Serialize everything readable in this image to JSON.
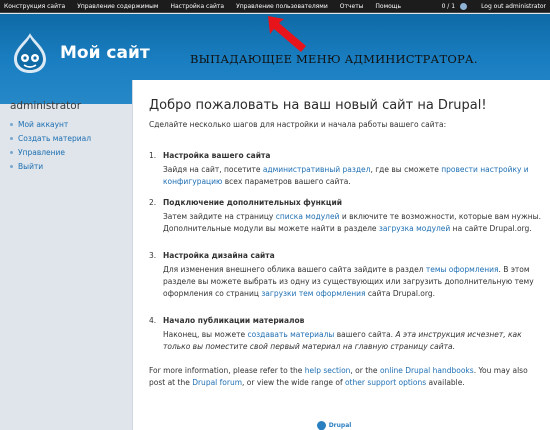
{
  "admin_menu": {
    "items": [
      "Конструкция сайта",
      "Управление содержимым",
      "Настройка сайта",
      "Управление пользователями",
      "Отчеты",
      "Помощь"
    ],
    "count": "0 / 1",
    "logout": "Log out administrator"
  },
  "header": {
    "site_name": "Мой сайт",
    "logo_icon": "drupal-drop-icon",
    "colors": {
      "background": "#1a7fc2",
      "admin_bar": "#1c1c1c"
    }
  },
  "annotation": {
    "text": "ВЫПАДАЮЩЕЕ МЕНЮ АДМИНИСТРАТОРА.",
    "arrow_color": "#e8141b"
  },
  "sidebar": {
    "user": "administrator",
    "items": [
      "Мой аккаунт",
      "Создать материал",
      "Управление",
      "Выйти"
    ]
  },
  "main": {
    "title": "Добро пожаловать на ваш новый сайт на Drupal!",
    "intro": "Сделайте несколько шагов для настройки и начала работы вашего сайта:",
    "steps": [
      {
        "num": "1.",
        "title": "Настройка вашего сайта",
        "p1": "Зайдя на сайт, посетите ",
        "l1": "административный раздел",
        "p2": ", где вы сможете ",
        "l2": "провести настройку и конфигурацию",
        "p3": " всех параметров вашего сайта."
      },
      {
        "num": "2.",
        "title": "Подключение дополнительных функций",
        "p1": "Затем зайдите на страницу ",
        "l1": "списка модулей",
        "p2": " и включите те возможности, которые вам нужны. Дополнительные модули вы можете найти в разделе ",
        "l2": "загрузка модулей",
        "p3": " на сайте Drupal.org."
      },
      {
        "num": "3.",
        "title": "Настройка дизайна сайта",
        "p1": "Для изменения внешнего облика вашего сайта зайдите в раздел ",
        "l1": "темы оформления",
        "p2": ". В этом разделе вы можете выбрать из одну из существующих или загрузить дополнительную тему оформления со страниц ",
        "l2": "загрузки тем оформления",
        "p3": " сайта Drupal.org."
      },
      {
        "num": "4.",
        "title": "Начало публикации материалов",
        "p1": "Наконец, вы можете ",
        "l1": "создавать материалы",
        "p2": " вашего сайта. ",
        "em": "А эта инструкция исчезнет, как только вы поместите свой первый материал на главную страницу сайта."
      }
    ],
    "more": {
      "p1": "For more information, please refer to the ",
      "l1": "help section",
      "p2": ", or the ",
      "l2": "online Drupal handbooks",
      "p3": ". You may also post at the ",
      "l3": "Drupal forum",
      "p4": ", or view the wide range of ",
      "l4": "other support options",
      "p5": " available."
    },
    "badge": "Drupal"
  }
}
